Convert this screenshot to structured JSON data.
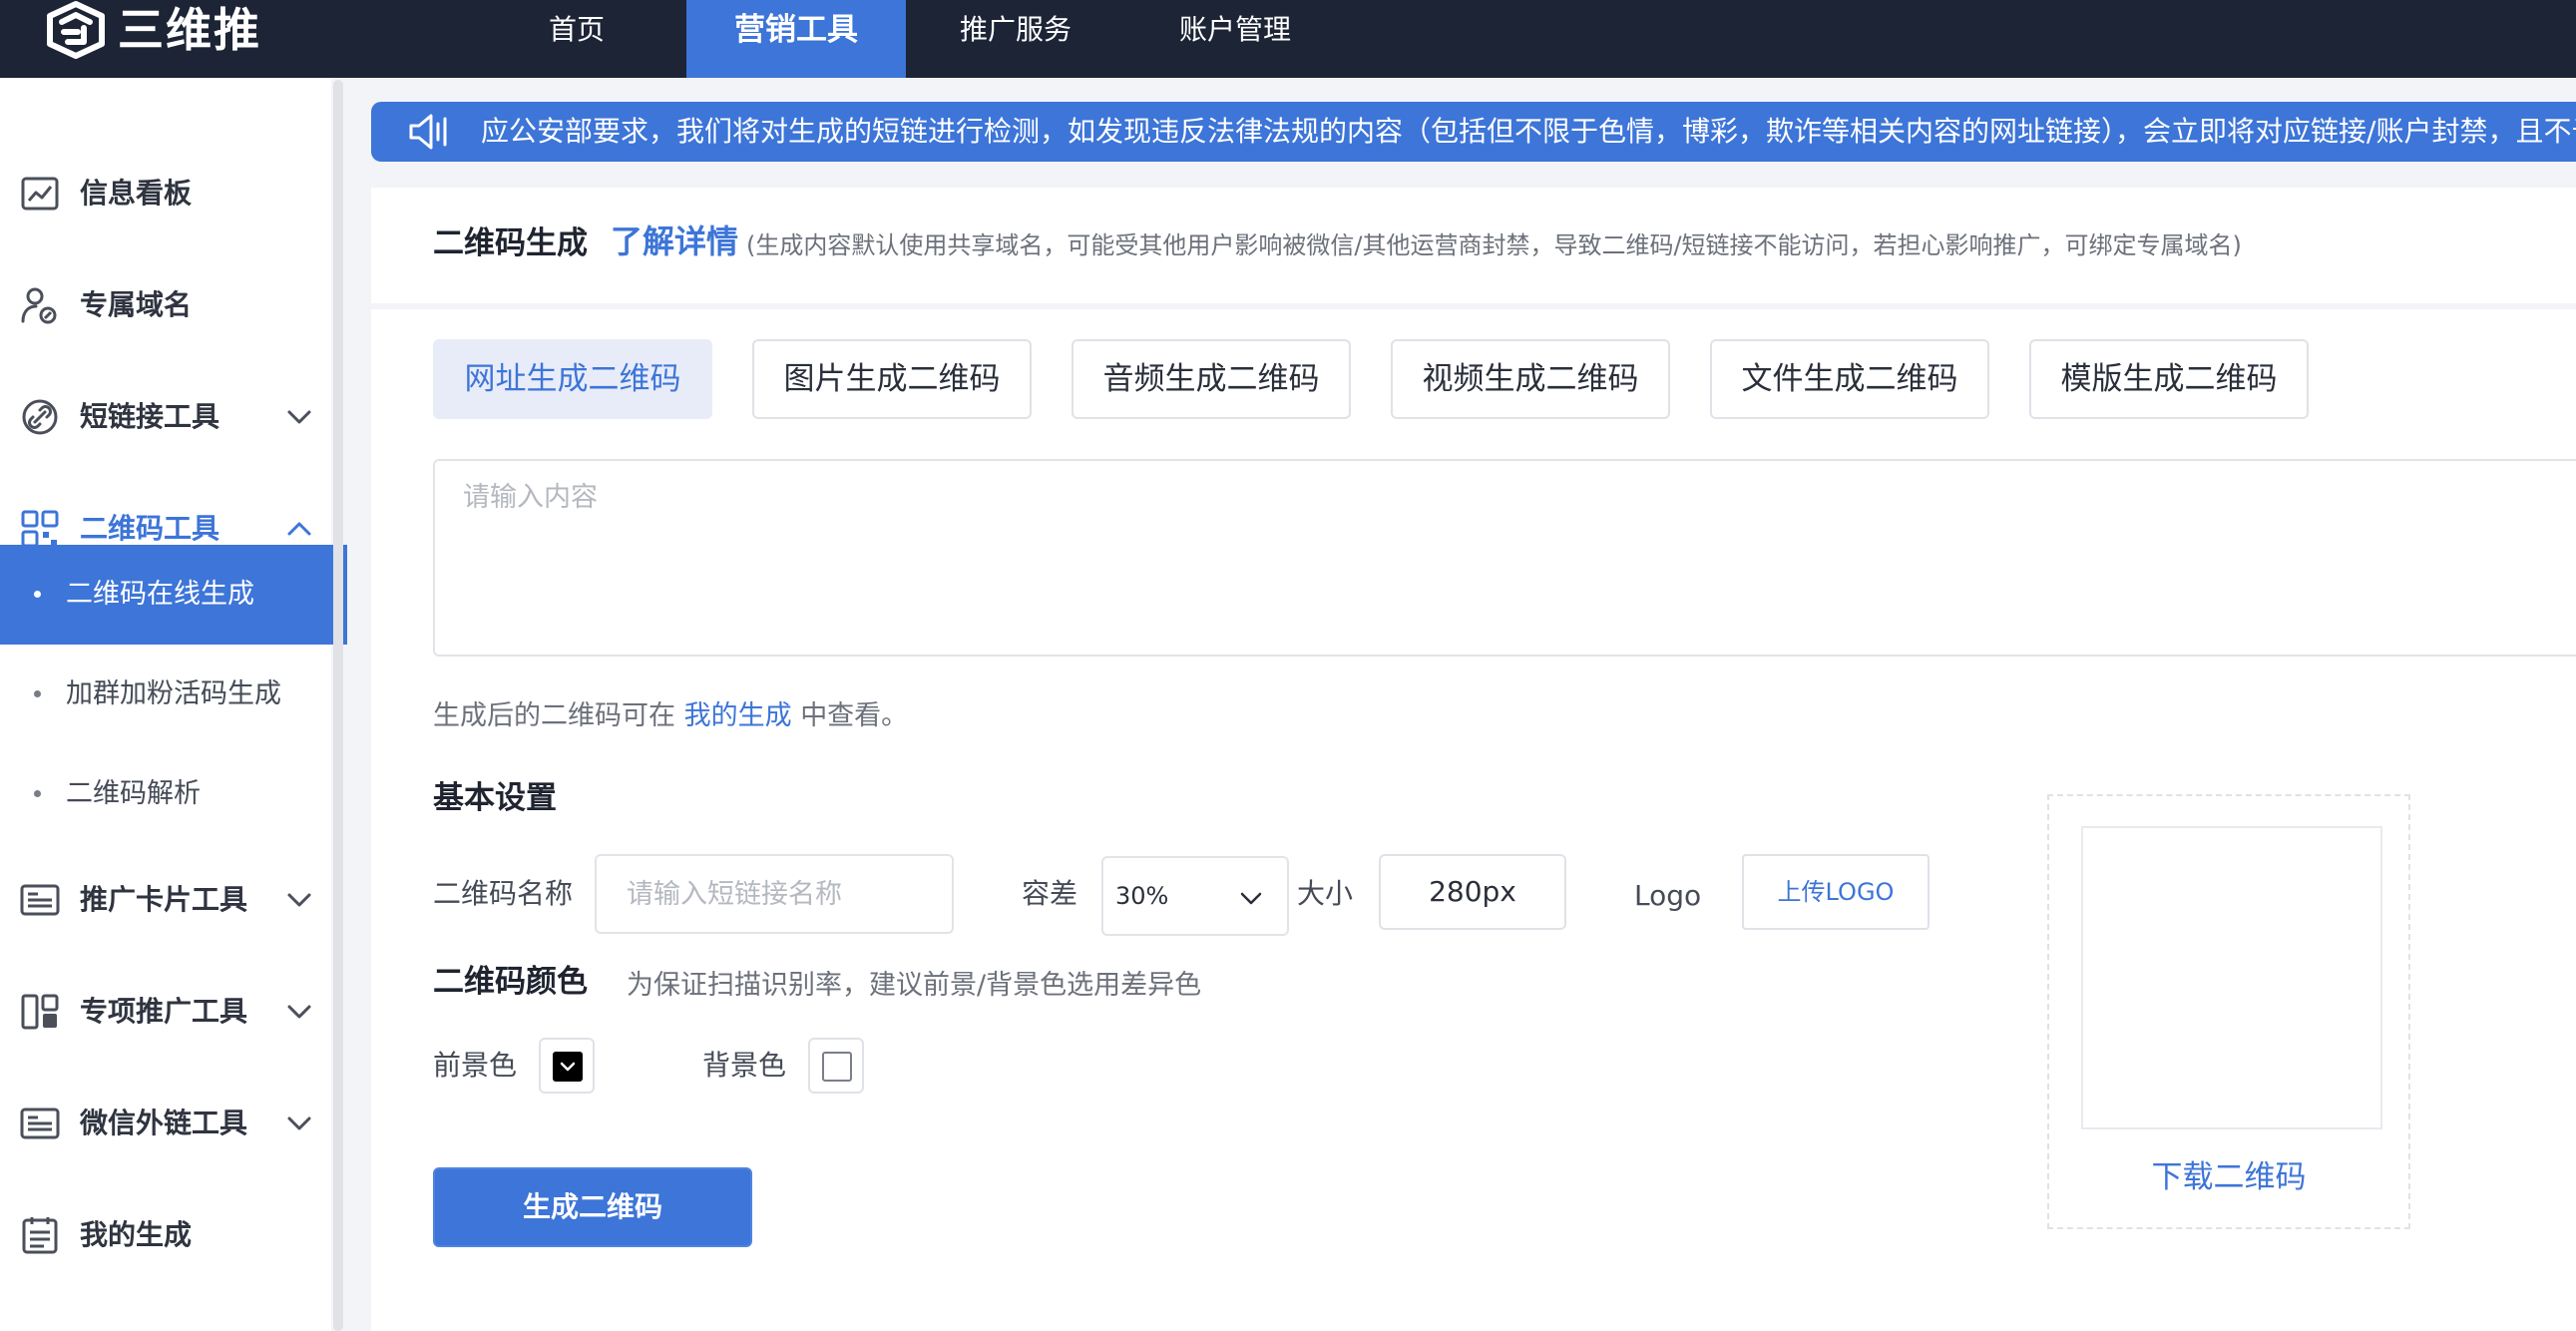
{
  "brand": {
    "name": "三维推"
  },
  "nav": {
    "items": [
      {
        "label": "首页"
      },
      {
        "label": "营销工具",
        "active": true
      },
      {
        "label": "推广服务"
      },
      {
        "label": "账户管理"
      }
    ]
  },
  "sidebar": {
    "groups": [
      {
        "label": "信息看板",
        "icon": "dashboard-icon"
      },
      {
        "label": "专属域名",
        "icon": "user-link-icon"
      },
      {
        "label": "短链接工具",
        "icon": "link-icon",
        "expandable": true
      },
      {
        "label": "二维码工具",
        "icon": "qrcode-icon",
        "expandable": true,
        "open": true
      },
      {
        "label": "推广卡片工具",
        "icon": "card-icon",
        "expandable": true
      },
      {
        "label": "专项推广工具",
        "icon": "layout-icon",
        "expandable": true
      },
      {
        "label": "微信外链工具",
        "icon": "wechat-link-icon",
        "expandable": true
      },
      {
        "label": "我的生成",
        "icon": "list-icon"
      }
    ],
    "sub_items": [
      {
        "label": "二维码在线生成",
        "active": true
      },
      {
        "label": "加群加粉活码生成"
      },
      {
        "label": "二维码解析"
      }
    ]
  },
  "notice": {
    "text": "应公安部要求，我们将对生成的短链进行检测，如发现违反法律法规的内容（包括但不限于色情，博彩，欺诈等相关内容的网址链接），会立即将对应链接/账户封禁，且不予"
  },
  "header": {
    "title": "二维码生成",
    "link": "了解详情",
    "note": "(生成内容默认使用共享域名，可能受其他用户影响被微信/其他运营商封禁，导致二维码/短链接不能访问，若担心影响推广，可绑定专属域名)"
  },
  "tabs": [
    {
      "label": "网址生成二维码",
      "active": true
    },
    {
      "label": "图片生成二维码"
    },
    {
      "label": "音频生成二维码"
    },
    {
      "label": "视频生成二维码"
    },
    {
      "label": "文件生成二维码"
    },
    {
      "label": "模版生成二维码"
    }
  ],
  "content": {
    "placeholder": "请输入内容"
  },
  "hint": {
    "before": "生成后的二维码可在",
    "link": "我的生成",
    "after": "中查看。"
  },
  "basic": {
    "title": "基本设置",
    "name_label": "二维码名称",
    "name_placeholder": "请输入短链接名称",
    "tolerance_label": "容差",
    "tolerance_value": "30%",
    "size_label": "大小",
    "size_value": "280px",
    "logo_label": "Logo",
    "upload_label": "上传LOGO"
  },
  "color": {
    "title": "二维码颜色",
    "hint": "为保证扫描识别率，建议前景/背景色选用差异色",
    "fg_label": "前景色",
    "bg_label": "背景色",
    "fg_value": "#000000",
    "bg_value": "#ffffff"
  },
  "actions": {
    "generate": "生成二维码"
  },
  "preview": {
    "download": "下载二维码"
  },
  "colors": {
    "accent": "#3d75d8",
    "nav_bg": "#1c2436"
  }
}
